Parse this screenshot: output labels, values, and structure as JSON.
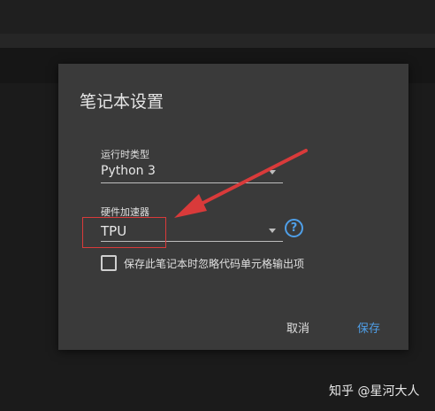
{
  "dialog": {
    "title": "笔记本设置",
    "runtime": {
      "label": "运行时类型",
      "value": "Python 3"
    },
    "accelerator": {
      "label": "硬件加速器",
      "value": "TPU"
    },
    "omit_output": {
      "label": "保存此笔记本时忽略代码单元格输出项",
      "checked": false
    },
    "buttons": {
      "cancel": "取消",
      "save": "保存"
    },
    "help_icon": "?"
  },
  "colors": {
    "accent": "#4f9fe8",
    "annotation": "#d93a3a",
    "dialog_bg": "#3a3a3a"
  },
  "watermark": "知乎 @星河大人"
}
